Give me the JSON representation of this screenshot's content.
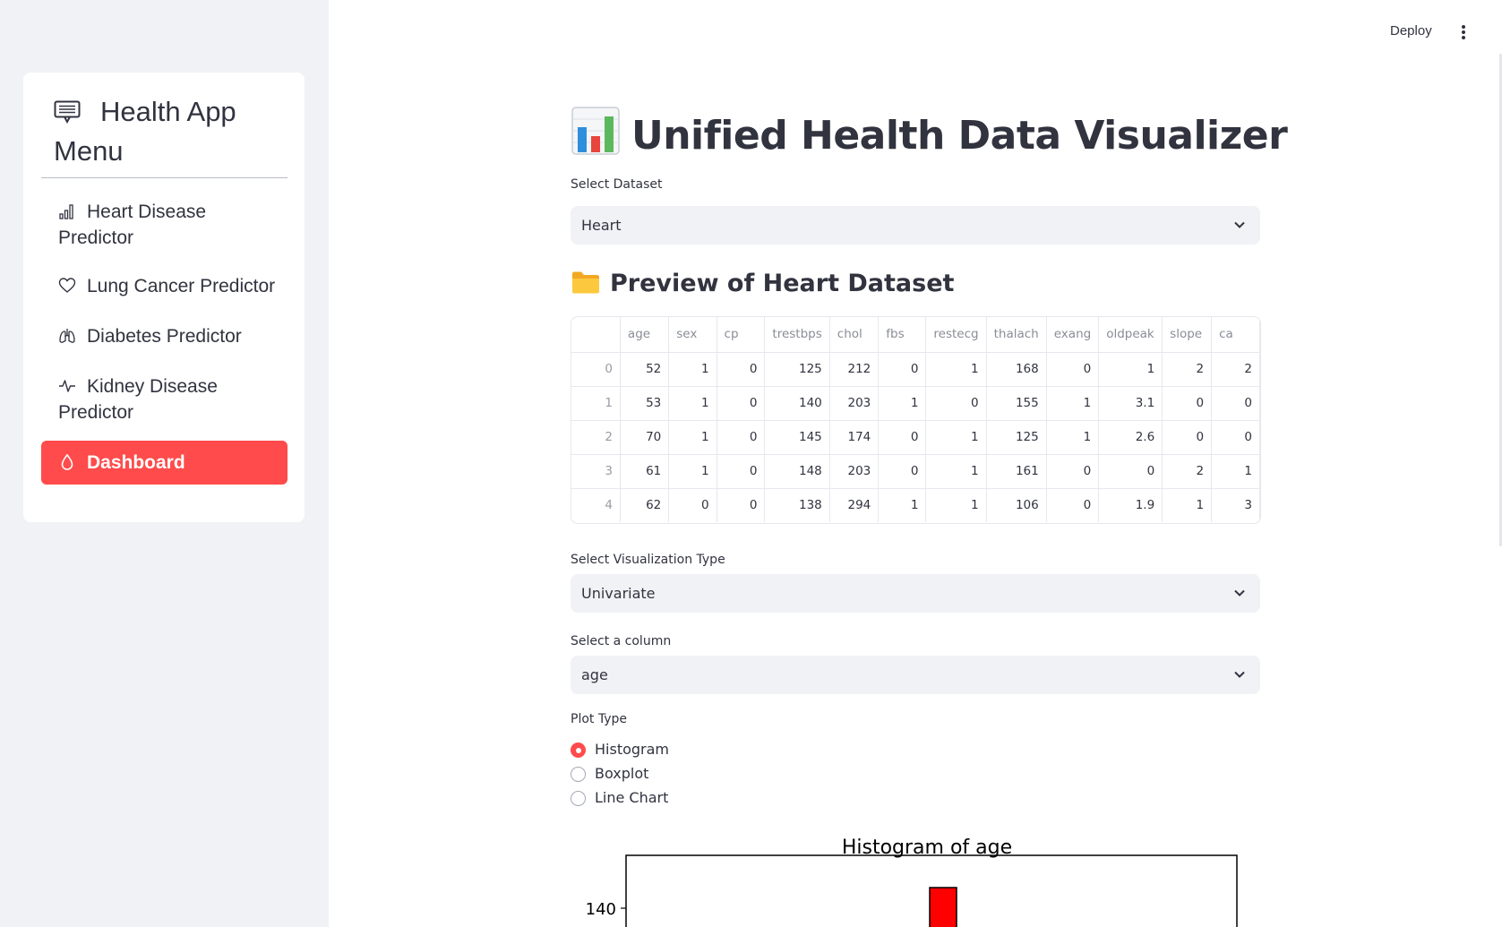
{
  "sidebar": {
    "title": "Health App Menu",
    "items": [
      {
        "label": "Heart Disease Predictor",
        "icon": "bar-chart-icon"
      },
      {
        "label": "Lung Cancer Predictor",
        "icon": "heart-icon"
      },
      {
        "label": "Diabetes Predictor",
        "icon": "lungs-icon"
      },
      {
        "label": "Kidney Disease Predictor",
        "icon": "activity-icon"
      },
      {
        "label": "Dashboard",
        "icon": "droplet-icon",
        "active": true
      }
    ]
  },
  "header": {
    "deploy_label": "Deploy"
  },
  "main": {
    "title": "Unified Health Data Visualizer",
    "dataset_select": {
      "label": "Select Dataset",
      "value": "Heart"
    },
    "preview_heading": "Preview of Heart Dataset",
    "table": {
      "columns": [
        "",
        "age",
        "sex",
        "cp",
        "trestbps",
        "chol",
        "fbs",
        "restecg",
        "thalach",
        "exang",
        "oldpeak",
        "slope",
        "ca"
      ],
      "rows": [
        [
          "0",
          "52",
          "1",
          "0",
          "125",
          "212",
          "0",
          "1",
          "168",
          "0",
          "1",
          "2",
          "2"
        ],
        [
          "1",
          "53",
          "1",
          "0",
          "140",
          "203",
          "1",
          "0",
          "155",
          "1",
          "3.1",
          "0",
          "0"
        ],
        [
          "2",
          "70",
          "1",
          "0",
          "145",
          "174",
          "0",
          "1",
          "125",
          "1",
          "2.6",
          "0",
          "0"
        ],
        [
          "3",
          "61",
          "1",
          "0",
          "148",
          "203",
          "0",
          "1",
          "161",
          "0",
          "0",
          "2",
          "1"
        ],
        [
          "4",
          "62",
          "0",
          "0",
          "138",
          "294",
          "1",
          "1",
          "106",
          "0",
          "1.9",
          "1",
          "3"
        ]
      ]
    },
    "viz_select": {
      "label": "Select Visualization Type",
      "value": "Univariate"
    },
    "column_select": {
      "label": "Select a column",
      "value": "age"
    },
    "plot_type": {
      "label": "Plot Type",
      "options": [
        "Histogram",
        "Boxplot",
        "Line Chart"
      ],
      "selected": "Histogram"
    }
  },
  "chart_data": {
    "type": "bar",
    "title": "Histogram of age",
    "y_tick_labels": [
      "140"
    ],
    "bar_color": "#ff0000",
    "visible_bar_peak": 145
  },
  "colors": {
    "accent": "#ff4b4b",
    "sidebar_bg": "#f0f2f6",
    "input_bg": "#f0f2f6",
    "text": "#31333f"
  }
}
